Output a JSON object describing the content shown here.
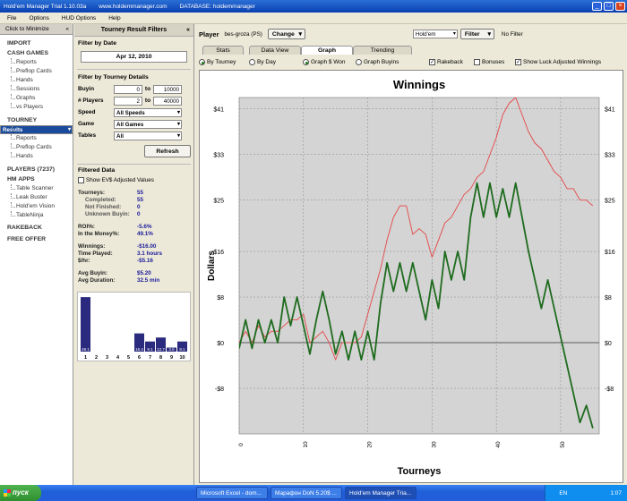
{
  "window": {
    "title": "Hold'em Manager Trial 1.10.03a",
    "site": "www.holdemmanager.com",
    "database": "DATABASE: holdemmanager",
    "min": "_",
    "max": "□",
    "close": "×"
  },
  "menu": [
    "File",
    "Options",
    "HUD Options",
    "Help"
  ],
  "nav": {
    "minimize_label": "Click to Minimize",
    "minimize_chevron": "«",
    "import": "IMPORT",
    "cash_games": "CASH GAMES",
    "cash_items": [
      "Reports",
      "Preflop Cards",
      "Hands",
      "Sessions",
      "Graphs",
      "vs Players"
    ],
    "tourney": "TOURNEY",
    "tourney_items": [
      "Results",
      "Reports",
      "Preflop Cards",
      "Hands"
    ],
    "players": "PLAYERS (7237)",
    "hm_apps": "HM APPS",
    "app_items": [
      "Table Scanner",
      "Leak Buster",
      "Hold'em Vision",
      "TableNinja"
    ],
    "rakeback": "RAKEBACK",
    "free_offer": "FREE OFFER"
  },
  "filters": {
    "title": "Tourney Result Filters",
    "collapse": "«",
    "by_date": "Filter by Date",
    "date": "Apr 12, 2010",
    "by_details": "Filter by Tourney Details",
    "buyin_label": "Buyin",
    "buyin_min": "0",
    "buyin_to": "to",
    "buyin_max": "10000",
    "players_label": "# Players",
    "players_min": "2",
    "players_to": "to",
    "players_max": "40000",
    "speed_label": "Speed",
    "speed_value": "All Speeds",
    "game_label": "Game",
    "game_value": "All Games",
    "tables_label": "Tables",
    "tables_value": "All",
    "refresh": "Refresh",
    "filtered_data": "Filtered Data",
    "show_ev": "Show EV$ Adjusted Values"
  },
  "stats": {
    "tourneys_k": "Tourneys:",
    "tourneys_v": "55",
    "completed_k": "Completed:",
    "completed_v": "55",
    "notfinished_k": "Not Finished:",
    "notfinished_v": "0",
    "unknown_k": "Unknown Buyin:",
    "unknown_v": "0",
    "roi_k": "ROI%:",
    "roi_v": "-5.6%",
    "itm_k": "In the Money%:",
    "itm_v": "49.1%",
    "winnings_k": "Winnings:",
    "winnings_v": "-$16.00",
    "time_k": "Time Played:",
    "time_v": "3.1 hours",
    "hr_k": "$/hr:",
    "hr_v": "-$5.16",
    "avgbuyin_k": "Avg Buyin:",
    "avgbuyin_v": "$5.20",
    "avgdur_k": "Avg Duration:",
    "avgdur_v": "32.5 min"
  },
  "histogram": {
    "categories": [
      "1",
      "2",
      "3",
      "4",
      "5",
      "6",
      "7",
      "8",
      "9",
      "10"
    ],
    "values": [
      49.1,
      0,
      0,
      0,
      0,
      16.4,
      9.1,
      12.7,
      3.6,
      9.1
    ],
    "labels": [
      "49.1",
      "",
      "",
      "",
      "",
      "16.4",
      "9.1",
      "12.7",
      "3.6",
      "9.1"
    ],
    "bar_color": "#2a2a7e"
  },
  "player_bar": {
    "player_label": "Player",
    "player_value": "bes-groza (PS)",
    "change": "Change",
    "game_select": "Hold'em",
    "filter_btn": "Filter",
    "filter_status": "No Filter"
  },
  "tabs": [
    "Stats",
    "Data View",
    "Graph",
    "Trending"
  ],
  "options": {
    "by_tourney": "By Tourney",
    "by_day": "By Day",
    "graph_won": "Graph $ Won",
    "graph_buyins": "Graph Buyins",
    "rakeback": "Rakeback",
    "bonuses": "Bonuses",
    "luck": "Show Luck Adjusted Winnings",
    "rakeback_checked": "✓",
    "luck_checked": "✓"
  },
  "chart_data": {
    "type": "line",
    "title": "Winnings",
    "xlabel": "Tourneys",
    "ylabel": "Dollars",
    "xlim": [
      0,
      56
    ],
    "ylim": [
      -16,
      43
    ],
    "xticks": [
      0,
      10,
      20,
      30,
      40,
      50
    ],
    "yticks": [
      41,
      33,
      25,
      16,
      8,
      0,
      -8
    ],
    "ytick_labels": [
      "$41",
      "$33",
      "$25",
      "$16",
      "$8",
      "$0",
      "-$8"
    ],
    "grid": true,
    "plot_bg": "#d4d4d4",
    "series": [
      {
        "color": "#1e6b1e",
        "x": [
          0,
          1,
          2,
          3,
          4,
          5,
          6,
          7,
          8,
          9,
          10,
          11,
          12,
          13,
          14,
          15,
          16,
          17,
          18,
          19,
          20,
          21,
          22,
          23,
          24,
          25,
          26,
          27,
          28,
          29,
          30,
          31,
          32,
          33,
          34,
          35,
          36,
          37,
          38,
          39,
          40,
          41,
          42,
          43,
          44,
          45,
          46,
          47,
          48,
          49,
          50,
          51,
          52,
          53,
          54,
          55
        ],
        "y": [
          -1,
          4,
          -1,
          4,
          0,
          4,
          0,
          8,
          3,
          8,
          3,
          -2,
          4,
          9,
          4,
          -2,
          2,
          -3,
          2,
          -3,
          2,
          -3,
          7,
          14,
          9,
          14,
          9,
          14,
          9,
          4,
          11,
          6,
          16,
          11,
          16,
          11,
          22,
          28,
          22,
          28,
          22,
          27,
          22,
          28,
          22,
          16,
          11,
          6,
          11,
          6,
          1,
          -4,
          -9,
          -14,
          -11,
          -15
        ]
      },
      {
        "color": "#e64444",
        "x": [
          0,
          1,
          2,
          3,
          4,
          5,
          6,
          7,
          8,
          9,
          10,
          11,
          12,
          13,
          14,
          15,
          16,
          17,
          18,
          19,
          20,
          21,
          22,
          23,
          24,
          25,
          26,
          27,
          28,
          29,
          30,
          31,
          32,
          33,
          34,
          35,
          36,
          37,
          38,
          39,
          40,
          41,
          42,
          43,
          44,
          45,
          46,
          47,
          48,
          49,
          50,
          51,
          52,
          53,
          54,
          55
        ],
        "y": [
          0,
          2,
          0,
          3,
          1,
          2,
          2,
          3,
          4,
          4,
          5,
          0,
          1,
          2,
          0,
          -3,
          0,
          0,
          0,
          1,
          5,
          9,
          13,
          18,
          22,
          24,
          24,
          19,
          20,
          19,
          15,
          18,
          21,
          22,
          24,
          26,
          27,
          29,
          30,
          33,
          36,
          40,
          42,
          43,
          40,
          37,
          35,
          34,
          32,
          30,
          29,
          27,
          27,
          25,
          25,
          24
        ]
      }
    ]
  },
  "taskbar": {
    "start": "пуск",
    "tasks": [
      "Microsoft Excel - dom...",
      "Марафон DoN 5.20$ ...",
      "Hold'em Manager Tria..."
    ],
    "lang": "EN",
    "clock": "1:07"
  }
}
